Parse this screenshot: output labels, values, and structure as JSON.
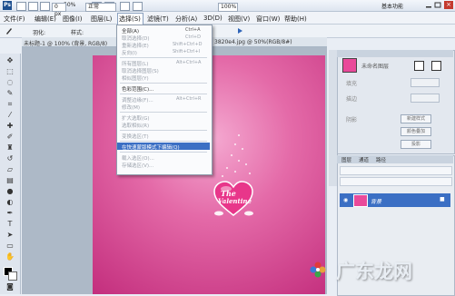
{
  "appbar": {
    "zoom": "50%",
    "workspace": "基本功能"
  },
  "menubar": {
    "items": [
      "文件(F)",
      "编辑(E)",
      "图像(I)",
      "图层(L)",
      "选择(S)",
      "滤镜(T)",
      "分析(A)",
      "3D(D)",
      "视图(V)",
      "窗口(W)",
      "帮助(H)"
    ]
  },
  "options": {
    "feather_label": "羽化:",
    "feather_value": "0 px",
    "style_label": "样式:",
    "style_value": "正常",
    "zoom_value": "100%"
  },
  "document": {
    "tab_left": "未标题-1 @ 100% (背景, RGB/8)",
    "tab_right": "3820e4.jpg @ 50%(RGB/8#)"
  },
  "canvas": {
    "heart_line1": "The",
    "heart_line2": "Valentine"
  },
  "select_menu": {
    "items": [
      {
        "label": "全部(A)",
        "key": "Ctrl+A",
        "enabled": true
      },
      {
        "label": "取消选择(D)",
        "key": "Ctrl+D",
        "enabled": false
      },
      {
        "label": "重新选择(E)",
        "key": "Shift+Ctrl+D",
        "enabled": false
      },
      {
        "label": "反向(I)",
        "key": "Shift+Ctrl+I",
        "enabled": false
      },
      {
        "label": "所有图层(L)",
        "key": "Alt+Ctrl+A",
        "enabled": false
      },
      {
        "label": "取消选择图层(S)",
        "key": "",
        "enabled": false
      },
      {
        "label": "相似图层(Y)",
        "key": "",
        "enabled": false
      },
      {
        "label": "色彩范围(C)...",
        "key": "",
        "enabled": true
      },
      {
        "label": "调整边缘(F)...",
        "key": "Alt+Ctrl+R",
        "enabled": false
      },
      {
        "label": "修改(M)",
        "key": "",
        "enabled": false
      },
      {
        "label": "扩大选取(G)",
        "key": "",
        "enabled": false
      },
      {
        "label": "选取相似(R)",
        "key": "",
        "enabled": false
      },
      {
        "label": "变换选区(T)",
        "key": "",
        "enabled": false
      },
      {
        "label": "在快速蒙版模式下编辑(Q)",
        "key": "",
        "enabled": true,
        "highlighted": true
      },
      {
        "label": "载入选区(O)...",
        "key": "",
        "enabled": false
      },
      {
        "label": "存储选区(V)...",
        "key": "",
        "enabled": false
      }
    ]
  },
  "styles_panel": {
    "style_name": "未命名图层",
    "labels": [
      "填充",
      "描边",
      "阴影"
    ],
    "buttons": [
      "新建样式",
      "颜色叠加",
      "投影"
    ]
  },
  "layers_panel": {
    "tabs": [
      "图层",
      "通道",
      "路径"
    ],
    "layer_name": "背景"
  },
  "watermark": {
    "text": "广东龙网"
  },
  "colors": {
    "accent": "#3b6fc4",
    "canvas_pink": "#e46aa8",
    "heart_pink": "#e8368a"
  }
}
